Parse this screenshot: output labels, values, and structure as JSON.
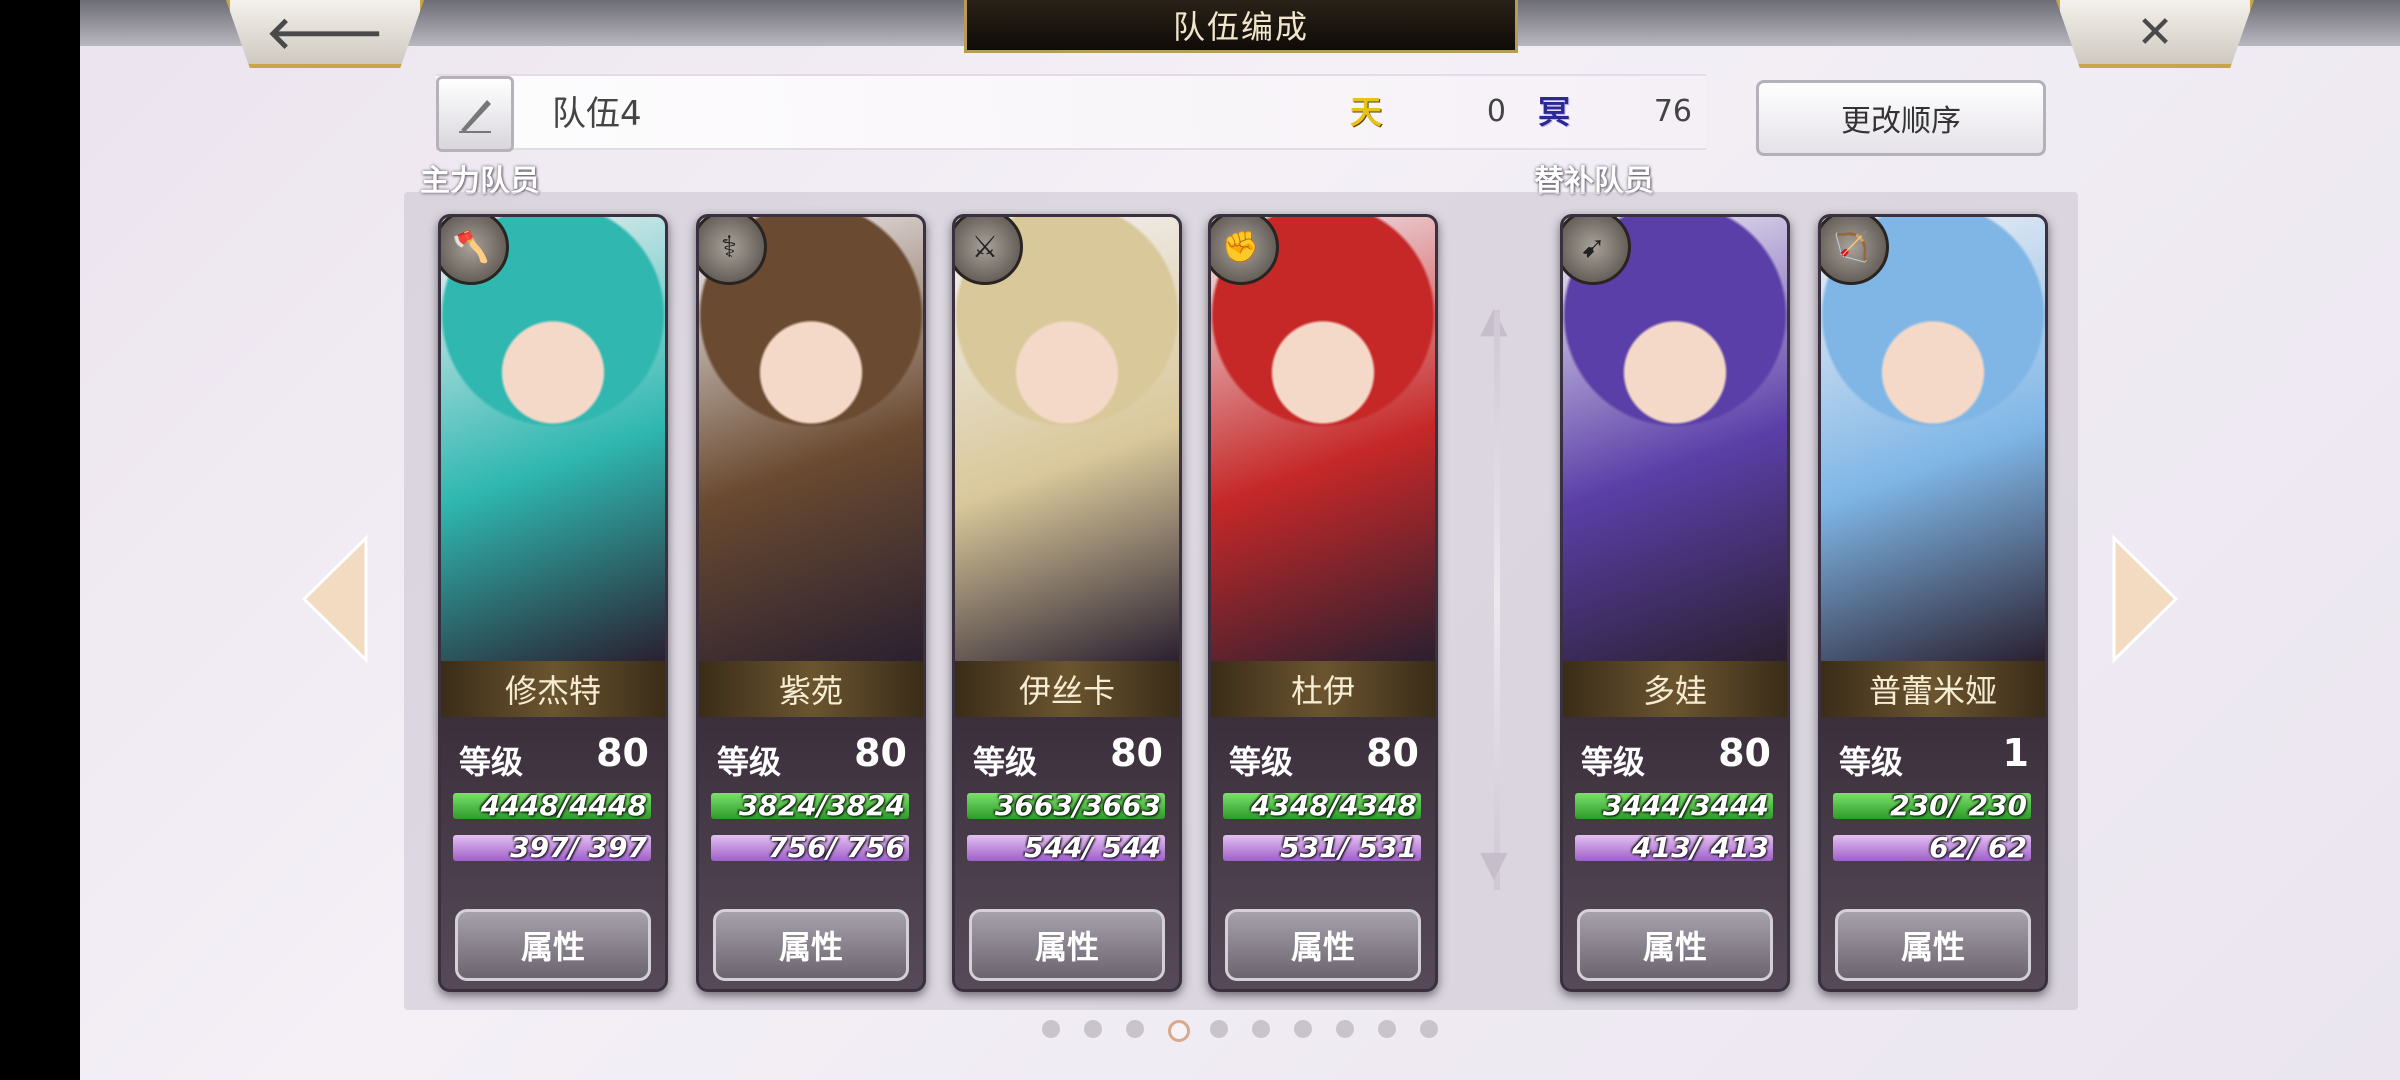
{
  "header": {
    "title": "队伍编成",
    "back_icon": "arrow-left-icon",
    "close_icon": "close-icon"
  },
  "team": {
    "name": "队伍4",
    "edit_icon": "quill-pen-icon",
    "heaven_icon": "天",
    "heaven_value": "0",
    "hell_icon": "冥",
    "hell_value": "76",
    "reorder_label": "更改顺序"
  },
  "sections": {
    "main_label": "主力队员",
    "sub_label": "替补队员"
  },
  "cards": [
    {
      "name": "修杰特",
      "class_icon": "axe-icon",
      "level_label": "等级",
      "level": "80",
      "hp": "4448/4448",
      "sp": "397/ 397",
      "attr_label": "属性",
      "accent": "#2fb7b0"
    },
    {
      "name": "紫苑",
      "class_icon": "staff-icon",
      "level_label": "等级",
      "level": "80",
      "hp": "3824/3824",
      "sp": "756/ 756",
      "attr_label": "属性",
      "accent": "#6a4a30"
    },
    {
      "name": "伊丝卡",
      "class_icon": "sword-icon",
      "level_label": "等级",
      "level": "80",
      "hp": "3663/3663",
      "sp": "544/ 544",
      "attr_label": "属性",
      "accent": "#d9c89a"
    },
    {
      "name": "杜伊",
      "class_icon": "fist-icon",
      "level_label": "等级",
      "level": "80",
      "hp": "4348/4348",
      "sp": "531/ 531",
      "attr_label": "属性",
      "accent": "#c62828"
    },
    {
      "name": "多娃",
      "class_icon": "spear-icon",
      "level_label": "等级",
      "level": "80",
      "hp": "3444/3444",
      "sp": "413/ 413",
      "attr_label": "属性",
      "accent": "#5b3fa8"
    },
    {
      "name": "普蕾米娅",
      "class_icon": "bow-icon",
      "level_label": "等级",
      "level": "1",
      "hp": "230/ 230",
      "sp": "62/ 62",
      "attr_label": "属性",
      "accent": "#7fb6e6"
    }
  ],
  "pagination": {
    "total": 10,
    "active": 4
  },
  "colors": {
    "hp_bar": "#4cc24a",
    "sp_bar": "#c08ae0",
    "gold_border": "#c8a54a"
  }
}
